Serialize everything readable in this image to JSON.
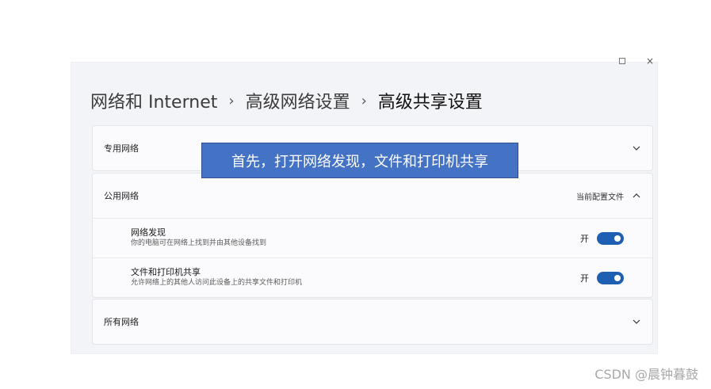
{
  "breadcrumb": {
    "part1": "网络和 Internet",
    "part2": "高级网络设置",
    "current": "高级共享设置",
    "separator": "›"
  },
  "window_controls": {
    "minimize": "–",
    "close": "×"
  },
  "sections": {
    "private": {
      "title": "专用网络"
    },
    "public": {
      "title": "公用网络",
      "status": "当前配置文件",
      "items": [
        {
          "title": "网络发现",
          "desc": "你的电脑可在网络上找到并由其他设备找到",
          "toggle_label": "开",
          "on": true
        },
        {
          "title": "文件和打印机共享",
          "desc": "允许网络上的其他人访问此设备上的共享文件和打印机",
          "toggle_label": "开",
          "on": true
        }
      ]
    },
    "all": {
      "title": "所有网络"
    }
  },
  "callout": "首先，打开网络发现，文件和打印机共享",
  "watermark": "CSDN @晨钟暮鼓",
  "colors": {
    "toggle_on": "#1e5fb4",
    "callout_bg": "#4472c4"
  }
}
